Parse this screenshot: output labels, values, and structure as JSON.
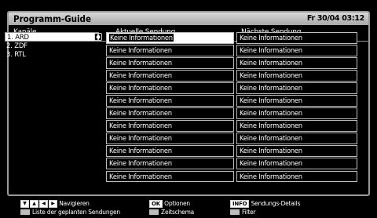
{
  "title": "Programm-Guide",
  "datetime": "Fr 30/04 03:12",
  "headers": {
    "channels": "Kanäle",
    "current": "Aktuelle Sendung",
    "next": "Nächste Sendung"
  },
  "channels": [
    "1. ARD",
    "2. ZDF",
    "3. RTL"
  ],
  "rows": [
    {
      "current": "Keine Informationen",
      "next": "Keine Informationen"
    },
    {
      "current": "Keine Informationen",
      "next": "Keine Informationen"
    },
    {
      "current": "Keine Informationen",
      "next": "Keine Informationen"
    },
    {
      "current": "Keine Informationen",
      "next": "Keine Informationen"
    },
    {
      "current": "Keine Informationen",
      "next": "Keine Informationen"
    },
    {
      "current": "Keine Informationen",
      "next": "Keine Informationen"
    },
    {
      "current": "Keine Informationen",
      "next": "Keine Informationen"
    },
    {
      "current": "Keine Informationen",
      "next": "Keine Informationen"
    },
    {
      "current": "Keine Informationen",
      "next": "Keine Informationen"
    },
    {
      "current": "Keine Informationen",
      "next": "Keine Informationen"
    },
    {
      "current": "Keine Informationen",
      "next": "Keine Informationen"
    },
    {
      "current": "Keine Informationen",
      "next": "Keine Informationen"
    }
  ],
  "footer": {
    "navigate": "Navigieren",
    "scheduled_list": "Liste der geplanten Sendungen",
    "ok_key": "OK",
    "options": "Optionen",
    "timeline": "Zeitschema",
    "info_key": "INFO",
    "details": "Sendungs-Details",
    "filter": "Filter"
  },
  "colors": {
    "frame": "#9a9a9a",
    "titlebar": "#c0c0c0",
    "highlight": "#ffffff"
  }
}
